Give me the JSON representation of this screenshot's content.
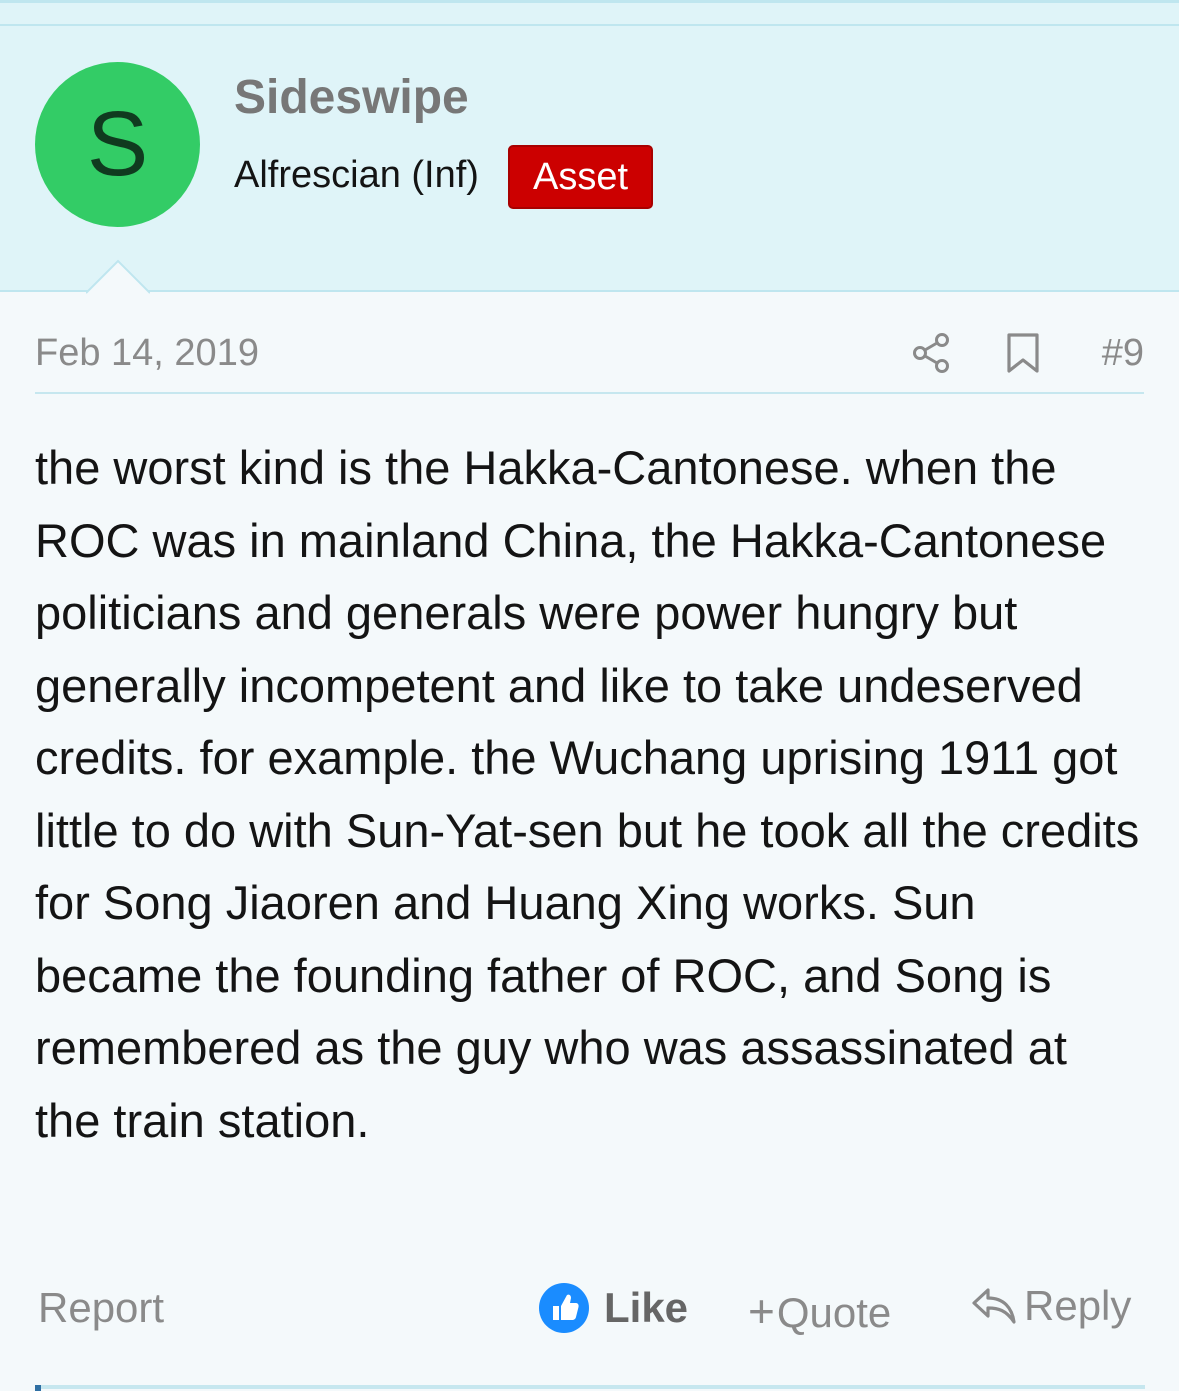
{
  "user": {
    "avatar_letter": "S",
    "avatar_color": "#33cc66",
    "name": "Sideswipe",
    "title": "Alfrescian (Inf)",
    "badge": "Asset",
    "badge_color": "#cc0000"
  },
  "post": {
    "date": "Feb 14, 2019",
    "share_icon": "share-icon",
    "bookmark_icon": "bookmark-icon",
    "number": "#9",
    "body": "the worst kind is the Hakka-Cantonese. when the ROC was in mainland China, the Hakka-Cantonese politicians and generals were power hungry but generally incompetent and like to take undeserved credits. for example. the Wuchang uprising 1911 got little to do with Sun-Yat-sen but he took all the credits for Song Jiaoren and Huang Xing works. Sun became the founding father of ROC, and Song is remembered as the guy who was assassinated at the train station."
  },
  "actions": {
    "report": "Report",
    "like": "Like",
    "like_icon": "thumbs-up-icon",
    "like_color": "#1a8cff",
    "quote_plus": "+",
    "quote": "Quote",
    "reply": "Reply",
    "reply_icon": "reply-arrow-icon"
  },
  "colors": {
    "header_bg": "#dff4f8",
    "page_bg": "#f4f9fb",
    "divider": "#c6e7ef"
  }
}
